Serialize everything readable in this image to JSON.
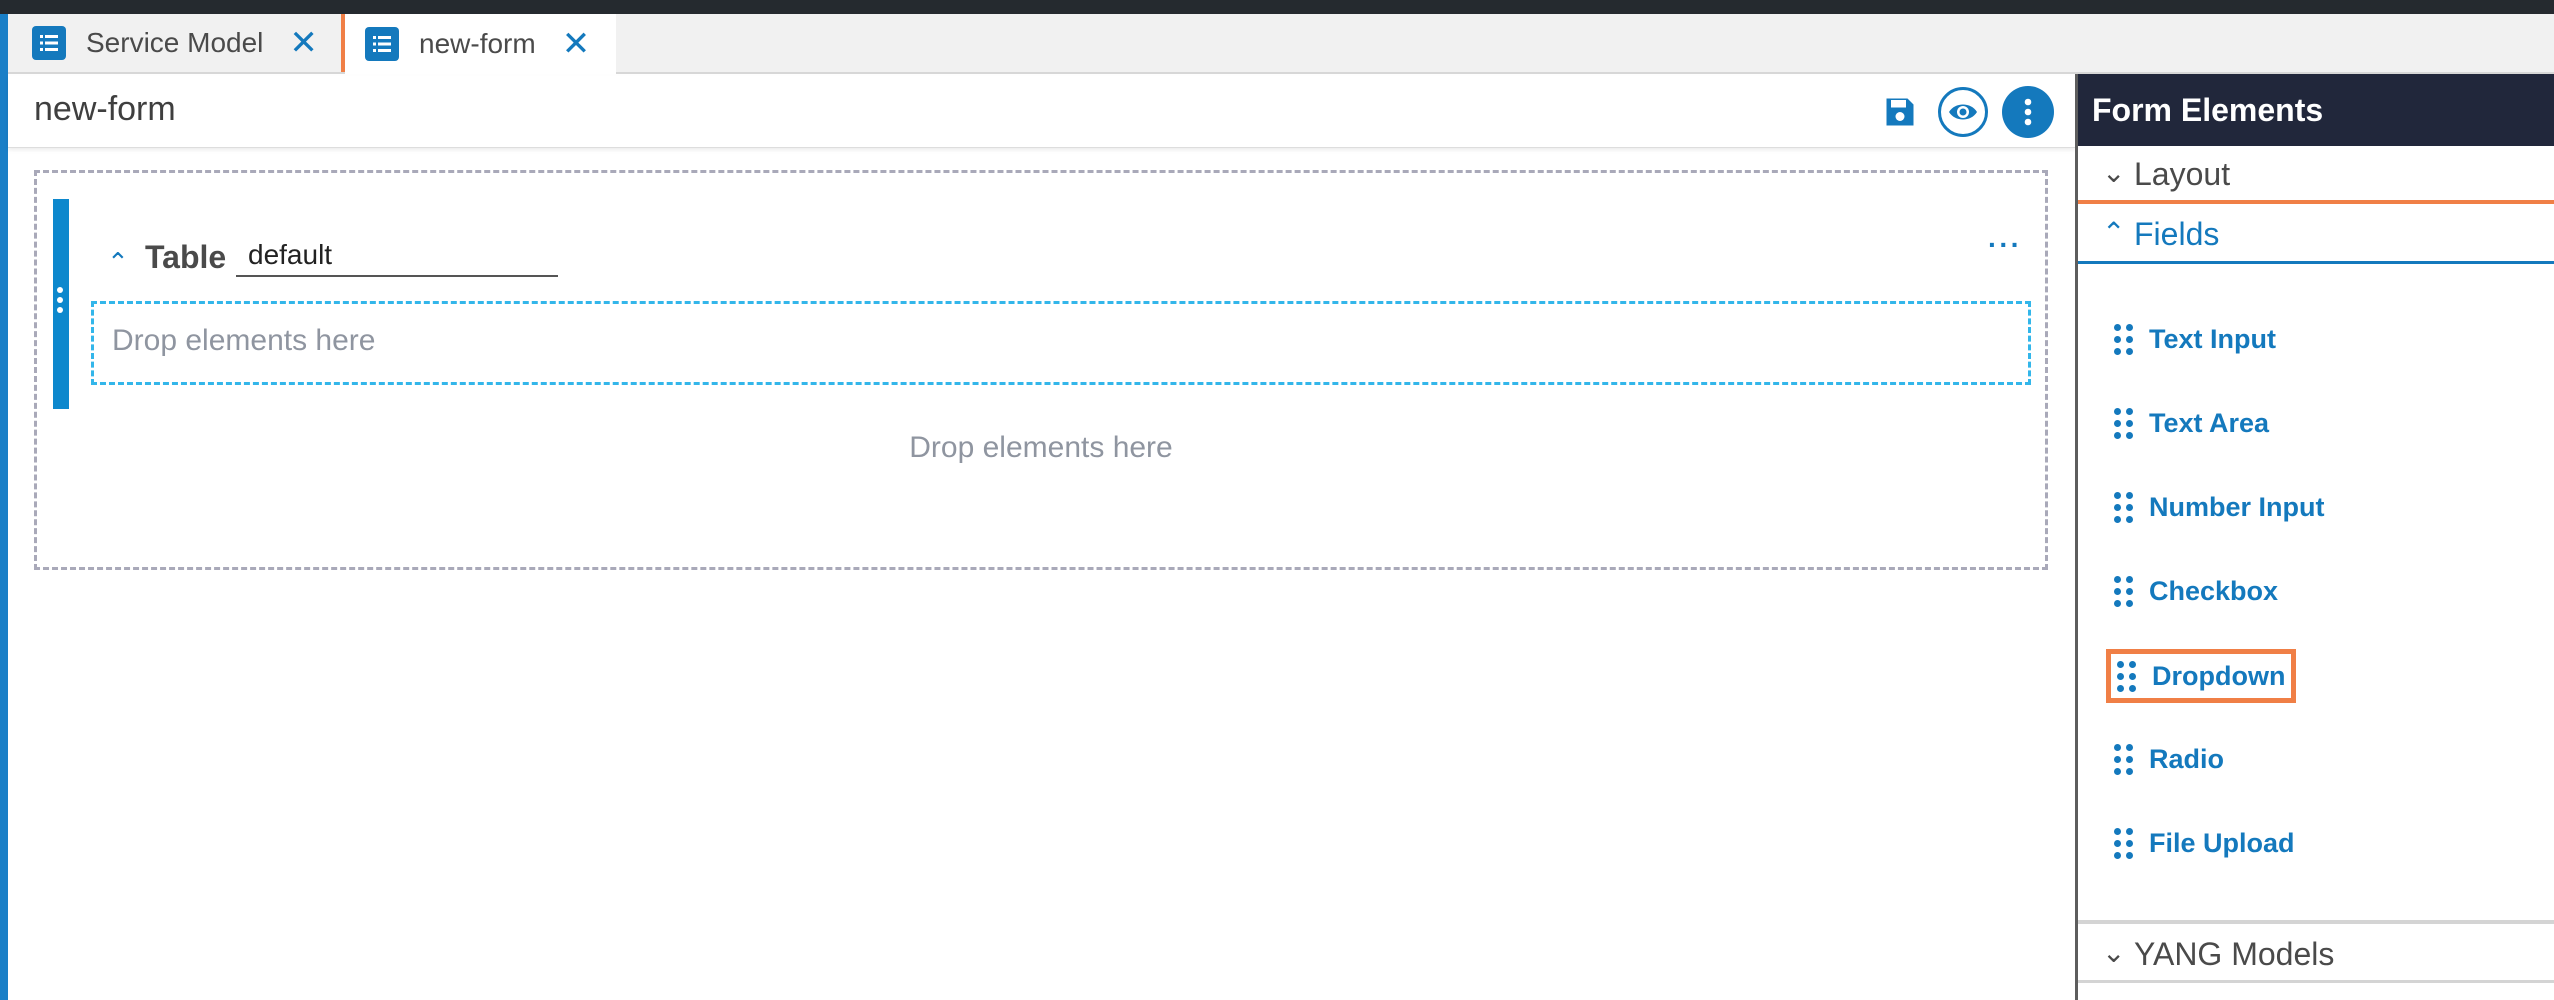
{
  "tabs": [
    {
      "label": "Service Model",
      "close": "✕"
    },
    {
      "label": "new-form",
      "close": "✕"
    }
  ],
  "editor": {
    "title": "new-form",
    "table": {
      "collapse_glyph": "⌃",
      "label": "Table",
      "name_value": "default",
      "more_glyph": "···",
      "drop_text": "Drop elements here"
    },
    "drop_text": "Drop elements here"
  },
  "panel": {
    "title": "Form Elements",
    "sections": {
      "layout": {
        "label": "Layout",
        "chevron": "⌄"
      },
      "fields": {
        "label": "Fields",
        "chevron": "⌃"
      },
      "yang": {
        "label": "YANG Models",
        "chevron": "⌄"
      }
    },
    "fields": [
      "Text Input",
      "Text Area",
      "Number Input",
      "Checkbox",
      "Dropdown",
      "Radio",
      "File Upload"
    ],
    "selected_field": "Dropdown"
  },
  "colors": {
    "accent": "#1479bd",
    "highlight": "#f07f46",
    "panel_header": "#21273b",
    "drop_zone_border": "#33b6ea"
  },
  "icons": [
    "list-icon",
    "close-icon",
    "save-icon",
    "eye-icon",
    "more-vertical-icon",
    "chevron-up-icon",
    "chevron-down-icon",
    "more-horizontal-icon",
    "drag-handle-icon"
  ]
}
